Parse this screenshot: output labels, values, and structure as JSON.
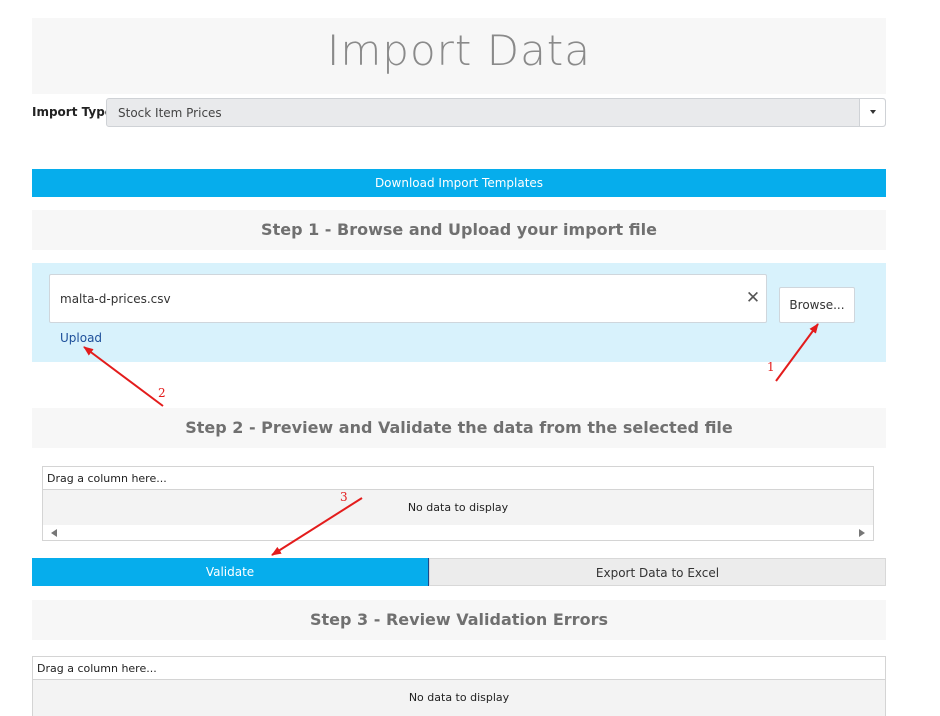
{
  "page": {
    "title": "Import Data"
  },
  "import_type": {
    "label": "Import Type:",
    "selected": "Stock Item Prices"
  },
  "download": {
    "label": "Download Import Templates"
  },
  "step1": {
    "title": "Step 1 - Browse and Upload your import file",
    "file_name": "malta-d-prices.csv",
    "clear_glyph": "✕",
    "browse_label": "Browse...",
    "upload_label": "Upload"
  },
  "step2": {
    "title": "Step 2 - Preview and Validate the data from the selected file",
    "grid": {
      "group_text": "Drag a column here...",
      "empty_text": "No data to display"
    },
    "validate_label": "Validate",
    "export_label": "Export Data to Excel"
  },
  "step3": {
    "title": "Step 3 - Review Validation Errors",
    "grid": {
      "group_text": "Drag a column here...",
      "empty_text": "No data to display"
    }
  },
  "annotations": {
    "one": "1",
    "two": "2",
    "three": "3",
    "color": "#e31c1c"
  },
  "colors": {
    "accent": "#06adec",
    "panel": "#d8f2fc",
    "band": "#f7f7f7"
  },
  "icons": {
    "clear": "close-icon",
    "dropdown": "caret-down-icon",
    "scroll_left": "arrow-left-icon",
    "scroll_right": "arrow-right-icon"
  }
}
